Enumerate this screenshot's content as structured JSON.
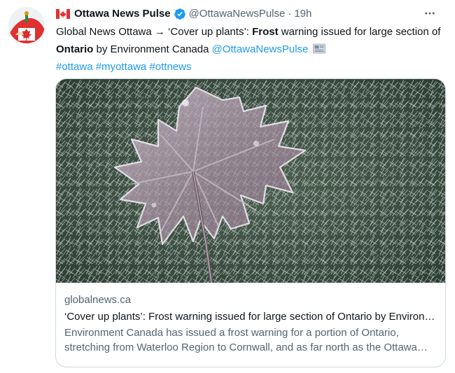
{
  "tweet": {
    "author": {
      "name": "Ottawa News Pulse",
      "handle": "@OttawaNewsPulse",
      "time": "19h",
      "separator": "·",
      "verified": true,
      "flag_icon": "canada-flag-icon"
    },
    "text": {
      "part1": "Global News Ottawa → ‘Cover up plants’: ",
      "bold1": "Frost",
      "part2": " warning issued for large section of ",
      "bold2": "Ontario",
      "part3": " by Environment Canada ",
      "mention": "@OttawaNewsPulse",
      "hashtags": [
        "#ottawa",
        "#myottawa",
        "#ottnews"
      ]
    },
    "card": {
      "domain": "globalnews.ca",
      "title": "‘Cover up plants’: Frost warning issued for large section of Ontario by Environment Canada",
      "description": "Environment Canada has issued a frost warning for a portion of Ontario, stretching from Waterloo Region to Cornwall, and as far north as the Ottawa Valley.",
      "image": "frost-covered-maple-leaf-on-grass"
    }
  },
  "colors": {
    "link": "#1d9bf0",
    "secondary_text": "#536471",
    "primary_text": "#0f1419",
    "border": "#cfd9de",
    "verified_badge": "#1d9bf0"
  }
}
